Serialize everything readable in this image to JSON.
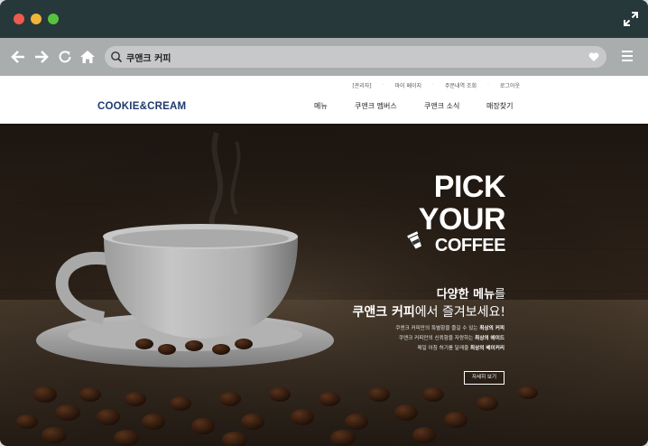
{
  "window": {
    "controls": [
      "close",
      "minimize",
      "zoom"
    ],
    "expand_icon": "expand-arrows-icon"
  },
  "toolbar": {
    "nav_icons": [
      "back-arrow-icon",
      "forward-arrow-icon",
      "reload-icon",
      "home-icon"
    ],
    "url_value": "쿠앤크 커피",
    "search_icon": "search-icon",
    "bookmark_icon": "heart-icon",
    "menu_icon": "hamburger-menu-icon"
  },
  "site": {
    "util_links": [
      "[관리자]",
      "마이 페이지",
      "주문내역 조회",
      "로그아웃"
    ],
    "logo": "COOKIE&CREAM",
    "menu": [
      "메뉴",
      "쿠앤크 멤버스",
      "쿠앤크 소식",
      "매장찾기"
    ]
  },
  "hero": {
    "pick_line1": "PICK",
    "pick_line2": "YOUR",
    "pick_line3": "COFFEE",
    "headline1_bold": "다양한 메뉴",
    "headline1_rest": "를",
    "headline2_bold": "쿠앤크 커피",
    "headline2_rest": "에서 즐겨보세요!",
    "desc1_text": "쿠앤크 커피만의 특별함을 즐길 수 있는 ",
    "desc1_bold": "최상의 커피",
    "desc2_text": "쿠앤크 커피만의 신뢰함을 자랑하는 ",
    "desc2_bold": "최상의 에이드",
    "desc3_text": "매일 아침 허기를 달래줄 ",
    "desc3_bold": "최상의 베이커리",
    "button": "자세히 보기"
  },
  "colors": {
    "titlebar": "#263839",
    "toolbar": "#aaadae",
    "logo": "#1f3a6d"
  }
}
